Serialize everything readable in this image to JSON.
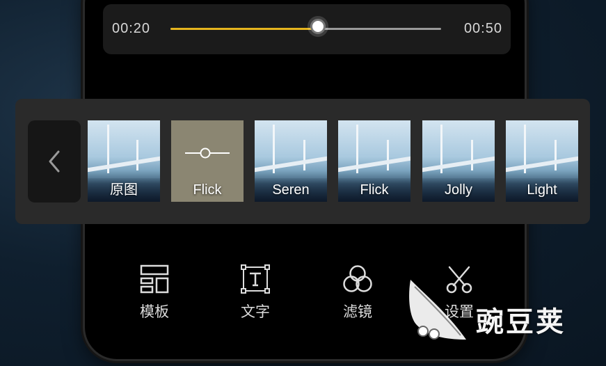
{
  "playback": {
    "current_time": "00:20",
    "total_time": "00:50",
    "progress": 0.545,
    "accent_color": "#e6b51e"
  },
  "filters": {
    "back_icon": "chevron-left-icon",
    "items": [
      {
        "label": "原图",
        "selected": false
      },
      {
        "label": "Flick",
        "selected": true
      },
      {
        "label": "Seren",
        "selected": false
      },
      {
        "label": "Flick",
        "selected": false
      },
      {
        "label": "Jolly",
        "selected": false
      },
      {
        "label": "Light",
        "selected": false
      }
    ]
  },
  "toolbar": {
    "items": [
      {
        "label": "模板",
        "icon": "template-icon"
      },
      {
        "label": "文字",
        "icon": "text-icon"
      },
      {
        "label": "滤镜",
        "icon": "filter-icon"
      },
      {
        "label": "设置",
        "icon": "scissors-icon"
      }
    ]
  },
  "watermark": {
    "text": "豌豆荚"
  }
}
